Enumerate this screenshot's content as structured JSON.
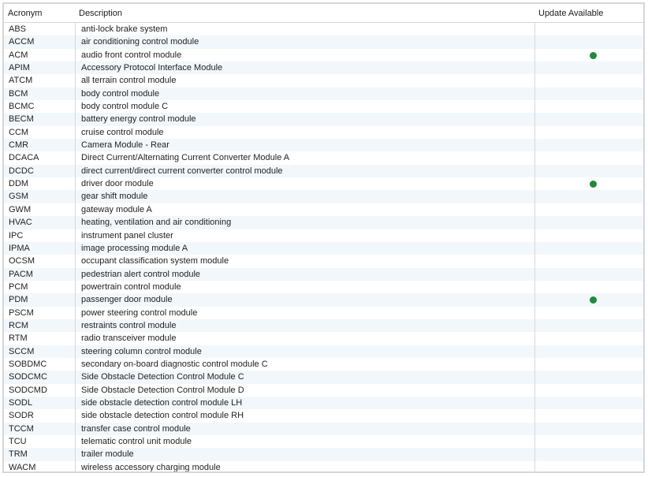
{
  "table": {
    "columns": {
      "acronym": "Acronym",
      "description": "Description",
      "update": "Update Available"
    },
    "rows": [
      {
        "acronym": "ABS",
        "description": "anti-lock brake system",
        "update": false
      },
      {
        "acronym": "ACCM",
        "description": "air conditioning control module",
        "update": false
      },
      {
        "acronym": "ACM",
        "description": "audio front control module",
        "update": true
      },
      {
        "acronym": "APIM",
        "description": "Accessory Protocol Interface Module",
        "update": false
      },
      {
        "acronym": "ATCM",
        "description": "all terrain control module",
        "update": false
      },
      {
        "acronym": "BCM",
        "description": "body control module",
        "update": false
      },
      {
        "acronym": "BCMC",
        "description": "body control module C",
        "update": false
      },
      {
        "acronym": "BECM",
        "description": "battery energy control module",
        "update": false
      },
      {
        "acronym": "CCM",
        "description": "cruise control module",
        "update": false
      },
      {
        "acronym": "CMR",
        "description": "Camera Module - Rear",
        "update": false
      },
      {
        "acronym": "DCACA",
        "description": "Direct Current/Alternating Current Converter Module A",
        "update": false
      },
      {
        "acronym": "DCDC",
        "description": "direct current/direct current converter control module",
        "update": false
      },
      {
        "acronym": "DDM",
        "description": "driver door module",
        "update": true
      },
      {
        "acronym": "GSM",
        "description": "gear shift module",
        "update": false
      },
      {
        "acronym": "GWM",
        "description": "gateway module A",
        "update": false
      },
      {
        "acronym": "HVAC",
        "description": "heating, ventilation and air conditioning",
        "update": false
      },
      {
        "acronym": "IPC",
        "description": "instrument panel cluster",
        "update": false
      },
      {
        "acronym": "IPMA",
        "description": "image processing module A",
        "update": false
      },
      {
        "acronym": "OCSM",
        "description": "occupant classification system module",
        "update": false
      },
      {
        "acronym": "PACM",
        "description": "pedestrian alert control module",
        "update": false
      },
      {
        "acronym": "PCM",
        "description": "powertrain control module",
        "update": false
      },
      {
        "acronym": "PDM",
        "description": "passenger door module",
        "update": true
      },
      {
        "acronym": "PSCM",
        "description": "power steering control module",
        "update": false
      },
      {
        "acronym": "RCM",
        "description": "restraints control module",
        "update": false
      },
      {
        "acronym": "RTM",
        "description": "radio transceiver module",
        "update": false
      },
      {
        "acronym": "SCCM",
        "description": "steering column control module",
        "update": false
      },
      {
        "acronym": "SOBDMC",
        "description": "secondary on-board diagnostic control module C",
        "update": false
      },
      {
        "acronym": "SODCMC",
        "description": "Side Obstacle Detection Control Module C",
        "update": false
      },
      {
        "acronym": "SODCMD",
        "description": "Side Obstacle Detection Control Module D",
        "update": false
      },
      {
        "acronym": "SODL",
        "description": "side obstacle detection control module LH",
        "update": false
      },
      {
        "acronym": "SODR",
        "description": "side obstacle detection control module RH",
        "update": false
      },
      {
        "acronym": "TCCM",
        "description": "transfer case control module",
        "update": false
      },
      {
        "acronym": "TCU",
        "description": "telematic control unit module",
        "update": false
      },
      {
        "acronym": "TRM",
        "description": "trailer module",
        "update": false
      },
      {
        "acronym": "WACM",
        "description": "wireless accessory charging module",
        "update": false
      }
    ]
  },
  "colors": {
    "update_dot": "#1e8b3a",
    "row_stripe": "#f2f7fb",
    "grid_line": "#d8d8d8"
  }
}
